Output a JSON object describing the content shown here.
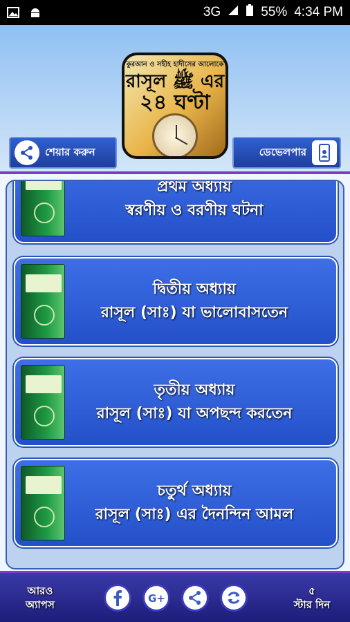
{
  "status": {
    "network": "3G",
    "battery": "55%",
    "time": "4:34 PM"
  },
  "cover": {
    "subtitle": "কুরআন ও সহীহ হাদীসের আলোকে",
    "title_line1": "রাসূল ﷺ এর",
    "title_line2": "২৪ ঘণ্টা"
  },
  "header": {
    "share_label": "শেয়ার করুন",
    "developer_label": "ডেভেলপার"
  },
  "chapters": [
    {
      "line1": "প্রথম অধ্যায়",
      "line2": "স্বরণীয় ও বরণীয় ঘটনা"
    },
    {
      "line1": "দ্বিতীয় অধ্যায়",
      "line2": "রাসূল (সাঃ) যা ভালোবাসতেন"
    },
    {
      "line1": "তৃতীয় অধ্যায়",
      "line2": "রাসূল (সাঃ) যা অপছন্দ করতেন"
    },
    {
      "line1": "চতুর্থ অধ্যায়",
      "line2": "রাসূল (সাঃ) এর দৈনন্দিন আমল"
    }
  ],
  "bottom": {
    "more_apps_line1": "আরও",
    "more_apps_line2": "অ্যাপস",
    "rate_line1": "৫",
    "rate_line2": "স্টার দিন"
  },
  "colors": {
    "accent": "#7d3cc5",
    "card": "#2350c9",
    "bottom_bar": "#1d1d7a"
  }
}
